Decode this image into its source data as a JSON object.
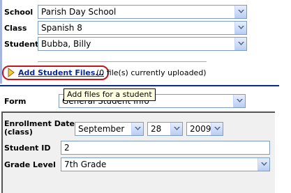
{
  "school": {
    "label": "School",
    "value": "Parish Day School"
  },
  "class_field": {
    "label": "Class",
    "value": "Spanish 8"
  },
  "student": {
    "label": "Student",
    "value": "Bubba, Billy"
  },
  "files": {
    "link_label": "Add Student Files...",
    "status_text": "(0 file(s) currently uploaded)",
    "tooltip": "Add files for a student"
  },
  "form": {
    "label": "Form",
    "value": "General Student Info"
  },
  "enrollment": {
    "label_line1": "Enrollment Date",
    "label_line2": "(class)",
    "month": "September",
    "day": "28",
    "year": "2009"
  },
  "student_id": {
    "label": "Student ID",
    "value": "2"
  },
  "grade_level": {
    "label": "Grade Level",
    "value": "7th Grade"
  },
  "colors": {
    "accent": "#0b2a8f",
    "highlight_ring": "#c0161d",
    "link": "#0b2a8f"
  },
  "icons": [
    "dropdown-arrow-icon",
    "play-arrow-icon"
  ]
}
